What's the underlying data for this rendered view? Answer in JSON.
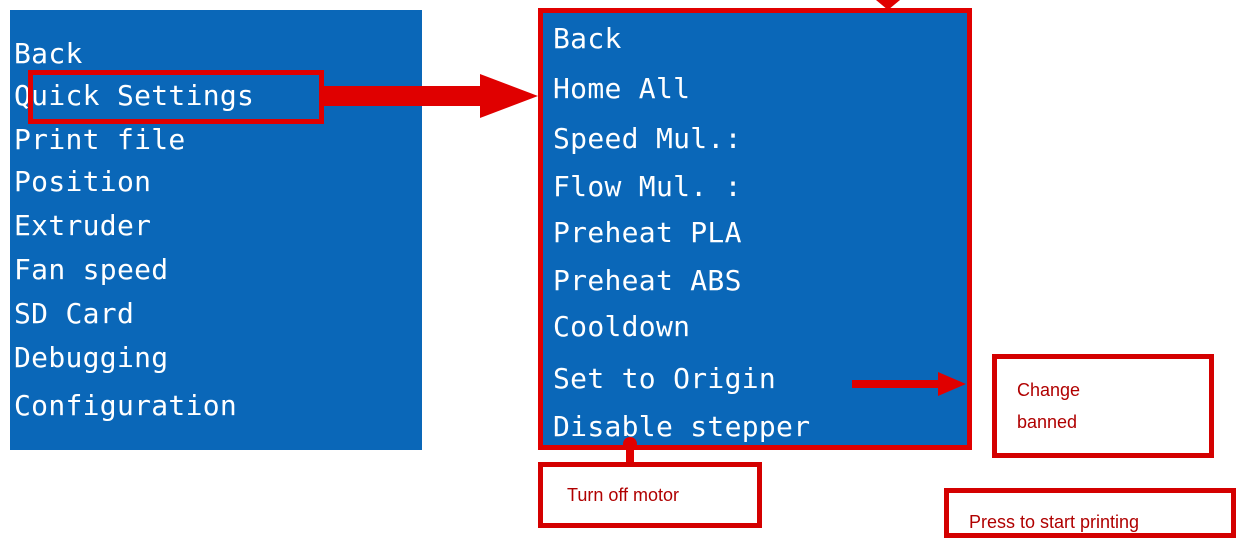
{
  "main_menu": {
    "items": [
      {
        "label": "Back"
      },
      {
        "label": "Quick Settings"
      },
      {
        "label": "Print file"
      },
      {
        "label": "Position"
      },
      {
        "label": "Extruder"
      },
      {
        "label": "Fan speed"
      },
      {
        "label": "SD Card"
      },
      {
        "label": "Debugging"
      },
      {
        "label": "Configuration"
      }
    ],
    "highlighted": "Quick Settings"
  },
  "quick_settings_menu": {
    "items": [
      {
        "label": "Back"
      },
      {
        "label": "Home All"
      },
      {
        "label": "Speed Mul.:"
      },
      {
        "label": "Flow Mul. :"
      },
      {
        "label": "Preheat PLA"
      },
      {
        "label": "Preheat ABS"
      },
      {
        "label": "Cooldown"
      },
      {
        "label": "Set to Origin"
      },
      {
        "label": "Disable stepper"
      }
    ]
  },
  "annotations": {
    "change_banned_line1": "Change",
    "change_banned_line2": "banned",
    "turn_off_motor": "Turn off motor",
    "press_to_start": "Press to start printing"
  },
  "colors": {
    "lcd_background": "#0a67b8",
    "lcd_text": "#ffffff",
    "annotation_red": "#e00000"
  }
}
